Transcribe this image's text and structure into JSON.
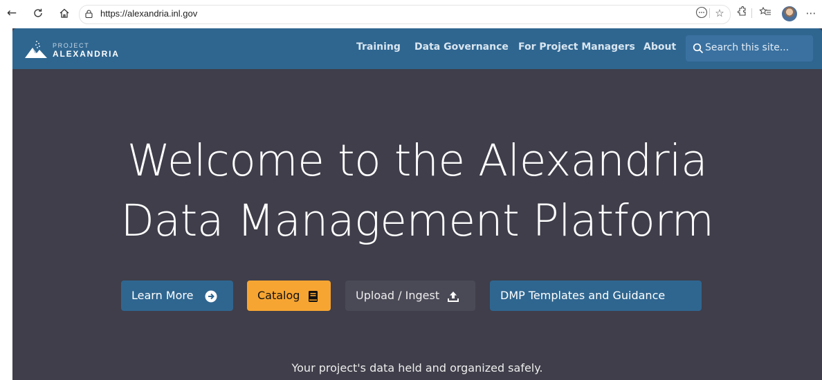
{
  "browser": {
    "url": "https://alexandria.inl.gov",
    "icons": [
      "back-arrow-icon",
      "reload-icon",
      "home-icon",
      "lock-icon",
      "reader-icon",
      "favorite-star-icon",
      "extensions-icon",
      "favorites-list-icon",
      "profile-avatar",
      "more-menu-icon"
    ]
  },
  "header": {
    "logo_small": "PROJECT",
    "logo_big": "ALEXANDRIA",
    "nav": [
      "Training",
      "Data Governance",
      "For Project Managers",
      "About"
    ],
    "search_placeholder": "Search this site..."
  },
  "hero": {
    "title_line1": "Welcome to the Alexandria",
    "title_line2": "Data Management Platform",
    "buttons": [
      {
        "label": "Learn More",
        "icon": "arrow-circle-right-icon"
      },
      {
        "label": "Catalog",
        "icon": "book-icon"
      },
      {
        "label": "Upload / Ingest",
        "icon": "upload-icon"
      },
      {
        "label": "DMP Templates and Guidance"
      }
    ],
    "tagline": "Your project's data held and organized safely."
  },
  "colors": {
    "header_blue": "#2f6690",
    "hero_bg": "#3f3e4a",
    "catalog_orange": "#f7a532"
  }
}
